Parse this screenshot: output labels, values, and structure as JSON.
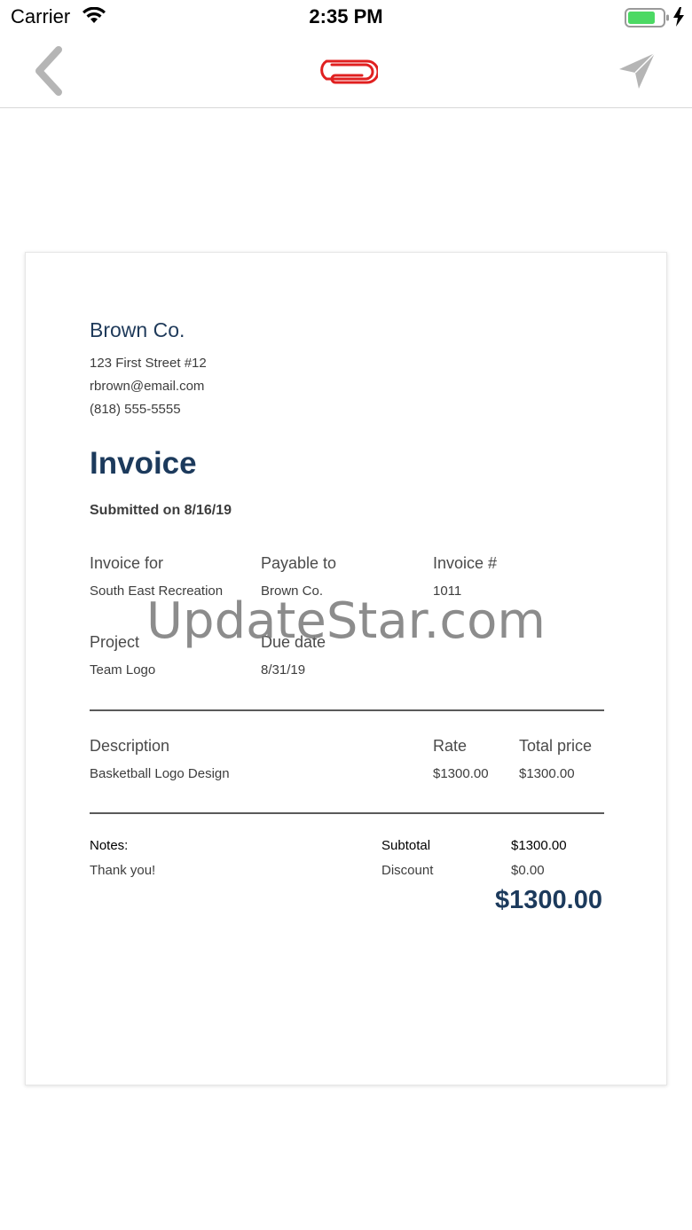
{
  "status_bar": {
    "carrier": "Carrier",
    "time": "2:35 PM",
    "wifi_icon": "wifi-icon",
    "battery_icon": "battery-icon",
    "charging_icon": "charging-bolt-icon",
    "battery_color": "#4cd964"
  },
  "nav": {
    "back_icon": "chevron-left-icon",
    "title_icon": "paperclip-icon",
    "send_icon": "paper-plane-icon",
    "title_icon_color": "#e02020",
    "icon_color": "#b5b5b5"
  },
  "invoice": {
    "company": {
      "name": "Brown Co.",
      "address": "123 First Street #12",
      "email": "rbrown@email.com",
      "phone": "(818) 555-5555"
    },
    "title": "Invoice",
    "submitted": "Submitted on 8/16/19",
    "fields": {
      "invoice_for_label": "Invoice for",
      "invoice_for_value": "South East Recreation",
      "payable_to_label": "Payable to",
      "payable_to_value": "Brown Co.",
      "invoice_number_label": "Invoice #",
      "invoice_number_value": "1011",
      "project_label": "Project",
      "project_value": "Team Logo",
      "due_date_label": "Due date",
      "due_date_value": "8/31/19"
    },
    "table": {
      "headers": {
        "description": "Description",
        "rate": "Rate",
        "total_price": "Total price"
      },
      "rows": [
        {
          "description": "Basketball Logo Design",
          "rate": "$1300.00",
          "total_price": "$1300.00"
        }
      ]
    },
    "notes_label": "Notes:",
    "notes_text": "Thank you!",
    "summary": {
      "subtotal_label": "Subtotal",
      "subtotal_value": "$1300.00",
      "discount_label": "Discount",
      "discount_value": "$0.00",
      "total": "$1300.00"
    },
    "accent_color": "#1c3a5c"
  },
  "watermark": "UpdateStar.com"
}
